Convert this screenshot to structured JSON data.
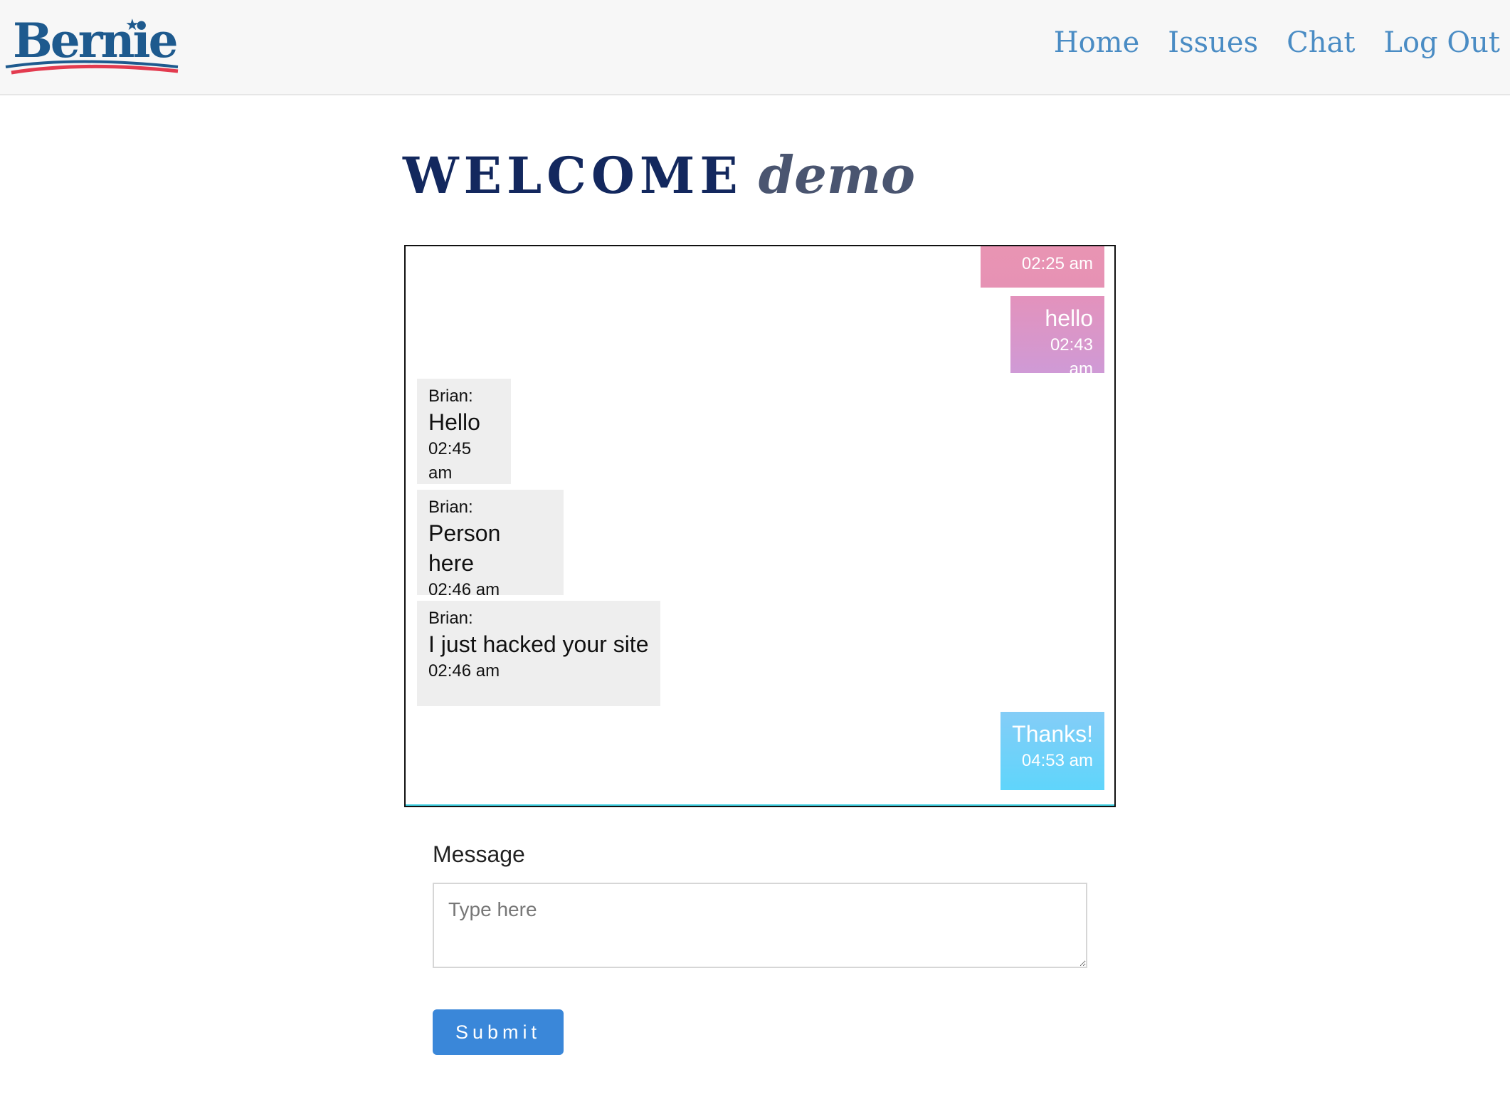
{
  "brand": {
    "name": "Bernie",
    "star": "★",
    "colors": {
      "blue": "#1e5a8e",
      "red": "#e33b4f"
    }
  },
  "nav": {
    "items": [
      {
        "label": "Home"
      },
      {
        "label": "Issues"
      },
      {
        "label": "Chat"
      },
      {
        "label": "Log Out"
      }
    ],
    "link_color": "#4a8cc4"
  },
  "welcome": {
    "word": "WELCOME",
    "username": "demo"
  },
  "chat": {
    "messages": [
      {
        "from_me": true,
        "sender": "",
        "text": "",
        "time": "02:25 am",
        "gradient": [
          "#e994b3",
          "#e692b4"
        ]
      },
      {
        "from_me": true,
        "sender": "",
        "text": "hello",
        "time": "02:43 am",
        "gradient": [
          "#e392bc",
          "#cf9ad6"
        ]
      },
      {
        "from_me": false,
        "sender": "Brian:",
        "text": "Hello",
        "time": "02:45 am"
      },
      {
        "from_me": false,
        "sender": "Brian:",
        "text": "Person here",
        "time": "02:46 am"
      },
      {
        "from_me": false,
        "sender": "Brian:",
        "text": "I just hacked your site",
        "time": "02:46 am"
      },
      {
        "from_me": true,
        "sender": "",
        "text": "Thanks!",
        "time": "04:53 am",
        "gradient": [
          "#84cdf7",
          "#5fd5fb"
        ]
      }
    ]
  },
  "form": {
    "label": "Message",
    "placeholder": "Type here",
    "submit_label": "Submit",
    "button_color": "#3a87d9"
  }
}
